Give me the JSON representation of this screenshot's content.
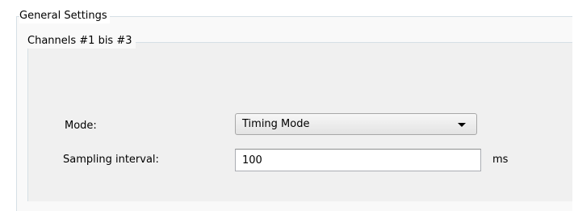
{
  "general_settings": {
    "title": "General Settings",
    "channels_group": {
      "title": "Channels #1 bis #3",
      "mode": {
        "label": "Mode:",
        "selected": "Timing Mode"
      },
      "sampling_interval": {
        "label": "Sampling interval:",
        "value": "100",
        "unit": "ms"
      }
    }
  }
}
